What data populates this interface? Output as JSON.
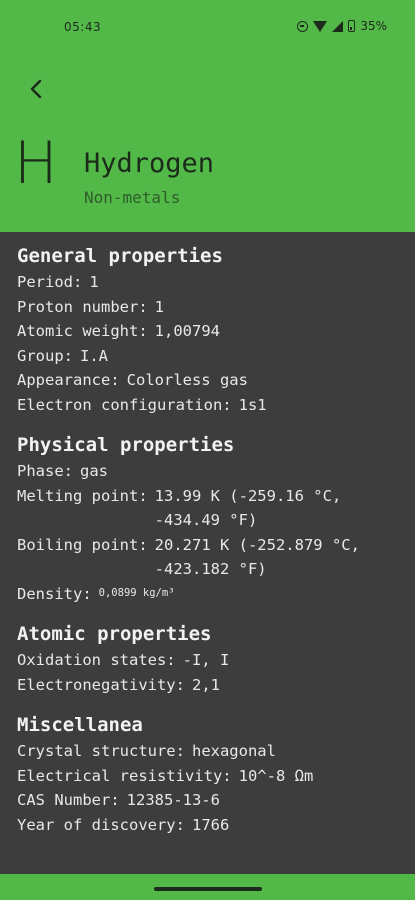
{
  "status_bar": {
    "time": "05:43",
    "battery": "35%"
  },
  "element": {
    "symbol": "H",
    "name": "Hydrogen",
    "category": "Non-metals"
  },
  "colors": {
    "header": "#52b848",
    "background": "#3d3d3d",
    "text": "#e8e8e8"
  },
  "sections": {
    "general": {
      "title": "General properties",
      "rows": [
        {
          "label": "Period:",
          "value": "1"
        },
        {
          "label": "Proton number:",
          "value": "1"
        },
        {
          "label": "Atomic weight:",
          "value": "1,00794"
        },
        {
          "label": "Group:",
          "value": "I.A"
        },
        {
          "label": "Appearance:",
          "value": "Colorless gas"
        },
        {
          "label": "Electron configuration:",
          "value": "1s1"
        }
      ]
    },
    "physical": {
      "title": "Physical properties",
      "rows": [
        {
          "label": "Phase:",
          "value": "gas"
        },
        {
          "label": "Melting point:",
          "value": "13.99 K (-259.16 °C, -434.49 °F)"
        },
        {
          "label": "Boiling point:",
          "value": "20.271 K (-252.879 °C, -423.182 °F)"
        },
        {
          "label": "Density:",
          "value": "0,0899 kg/m³"
        }
      ]
    },
    "atomic": {
      "title": "Atomic properties",
      "rows": [
        {
          "label": "Oxidation states:",
          "value": "-I, I"
        },
        {
          "label": "Electronegativity:",
          "value": "2,1"
        }
      ]
    },
    "misc": {
      "title": "Miscellanea",
      "rows": [
        {
          "label": "Crystal structure:",
          "value": "hexagonal"
        },
        {
          "label": "Electrical resistivity:",
          "value": "10^-8 Ωm"
        },
        {
          "label": "CAS Number:",
          "value": "12385-13-6"
        },
        {
          "label": "Year of discovery:",
          "value": "1766"
        }
      ]
    }
  }
}
